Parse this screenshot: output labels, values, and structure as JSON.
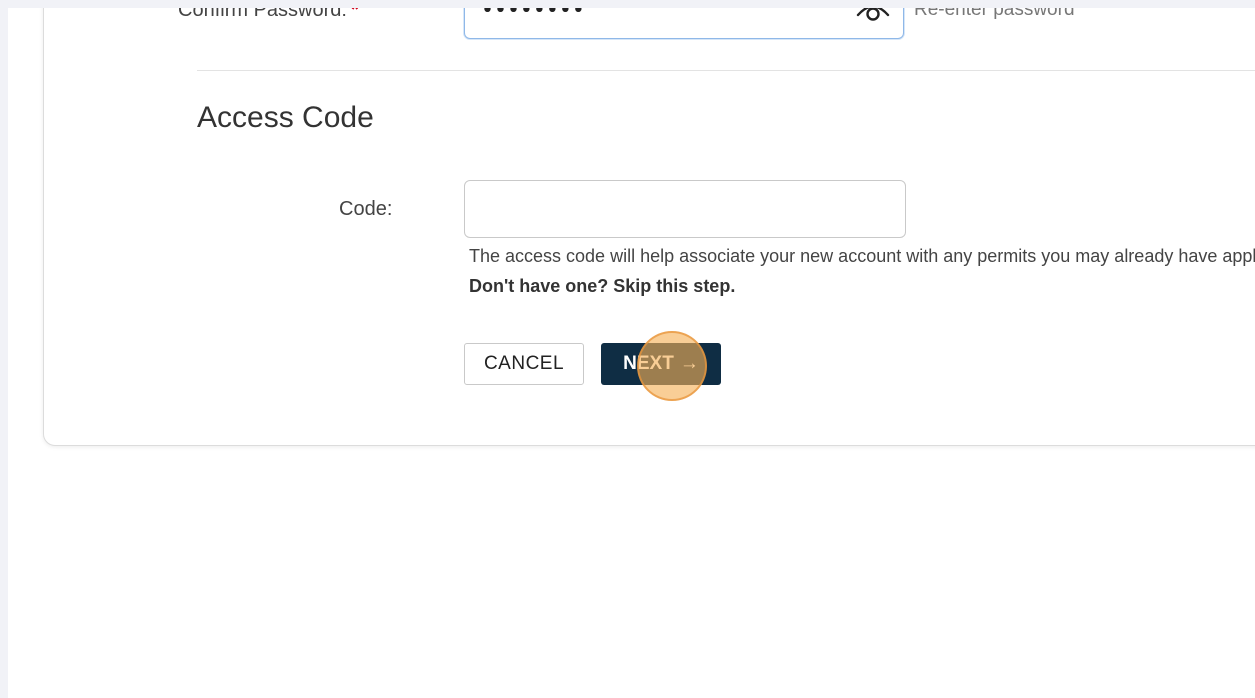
{
  "password_section": {
    "confirm_label": "Confirm Password:",
    "required_mark": "*",
    "masked_value": "••••••••",
    "hint": "Re-enter password",
    "toggle_icon": "eye-icon"
  },
  "access_code": {
    "title": "Access Code",
    "code_label": "Code:",
    "code_value": "",
    "help_text": "The access code will help associate your new account with any permits you may already have applied for.",
    "help_bold": "Don't have one? Skip this step."
  },
  "actions": {
    "cancel_label": "CANCEL",
    "next_label": "NEXT",
    "next_arrow": "→"
  },
  "colors": {
    "primary_button": "#0f2d44",
    "required": "#d0021b",
    "focus_border": "#8fb8e8"
  }
}
